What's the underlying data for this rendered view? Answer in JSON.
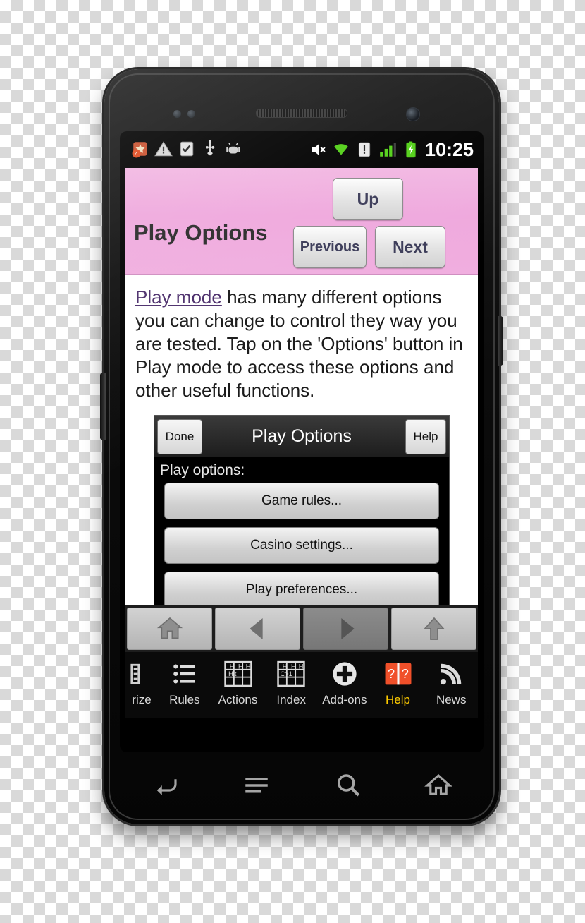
{
  "statusbar": {
    "icons": [
      {
        "name": "alarm-badge-icon",
        "badge": "4"
      },
      {
        "name": "warning-triangle-icon"
      },
      {
        "name": "checklist-icon"
      },
      {
        "name": "usb-icon"
      },
      {
        "name": "android-debug-icon"
      },
      {
        "name": "mute-speaker-icon"
      },
      {
        "name": "wifi-icon"
      },
      {
        "name": "sim-alert-icon"
      },
      {
        "name": "signal-bars-icon"
      },
      {
        "name": "battery-charging-icon"
      }
    ],
    "clock": "10:25"
  },
  "header": {
    "title": "Play Options",
    "buttons": {
      "up": "Up",
      "previous": "Previous",
      "next": "Next"
    }
  },
  "body": {
    "link_text": "Play mode",
    "paragraph": " has many different options you can change to control they way you are tested. Tap on the 'Options' button in Play mode to access these options and other useful functions."
  },
  "inner_dialog": {
    "done_label": "Done",
    "title": "Play Options",
    "help_label": "Help",
    "subtitle": "Play options:",
    "options": [
      "Game rules...",
      "Casino settings...",
      "Play preferences..."
    ]
  },
  "toolbar": {
    "buttons": [
      {
        "name": "home-icon",
        "enabled": true
      },
      {
        "name": "back-arrow-icon",
        "enabled": true
      },
      {
        "name": "forward-arrow-icon",
        "enabled": false
      },
      {
        "name": "up-arrow-icon",
        "enabled": true
      }
    ]
  },
  "tabbar": {
    "tabs": [
      {
        "label": "rize",
        "icon": "prize-icon",
        "clipped": true
      },
      {
        "label": "Rules",
        "icon": "list-icon"
      },
      {
        "label": "Actions",
        "icon": "hit-grid-icon"
      },
      {
        "label": "Index",
        "icon": "index-grid-icon"
      },
      {
        "label": "Add-ons",
        "icon": "plus-circle-icon"
      },
      {
        "label": "Help",
        "icon": "help-book-icon",
        "highlight_color": "#ffcc00"
      },
      {
        "label": "News",
        "icon": "rss-icon"
      }
    ]
  },
  "softkeys": [
    {
      "name": "back-softkey-icon"
    },
    {
      "name": "menu-softkey-icon"
    },
    {
      "name": "search-softkey-icon"
    },
    {
      "name": "home-softkey-icon"
    }
  ],
  "colors": {
    "header_pink": "#efa8dd",
    "help_yellow": "#ffcc00",
    "link_purple": "#4b2d6b",
    "status_green": "#52d017"
  }
}
